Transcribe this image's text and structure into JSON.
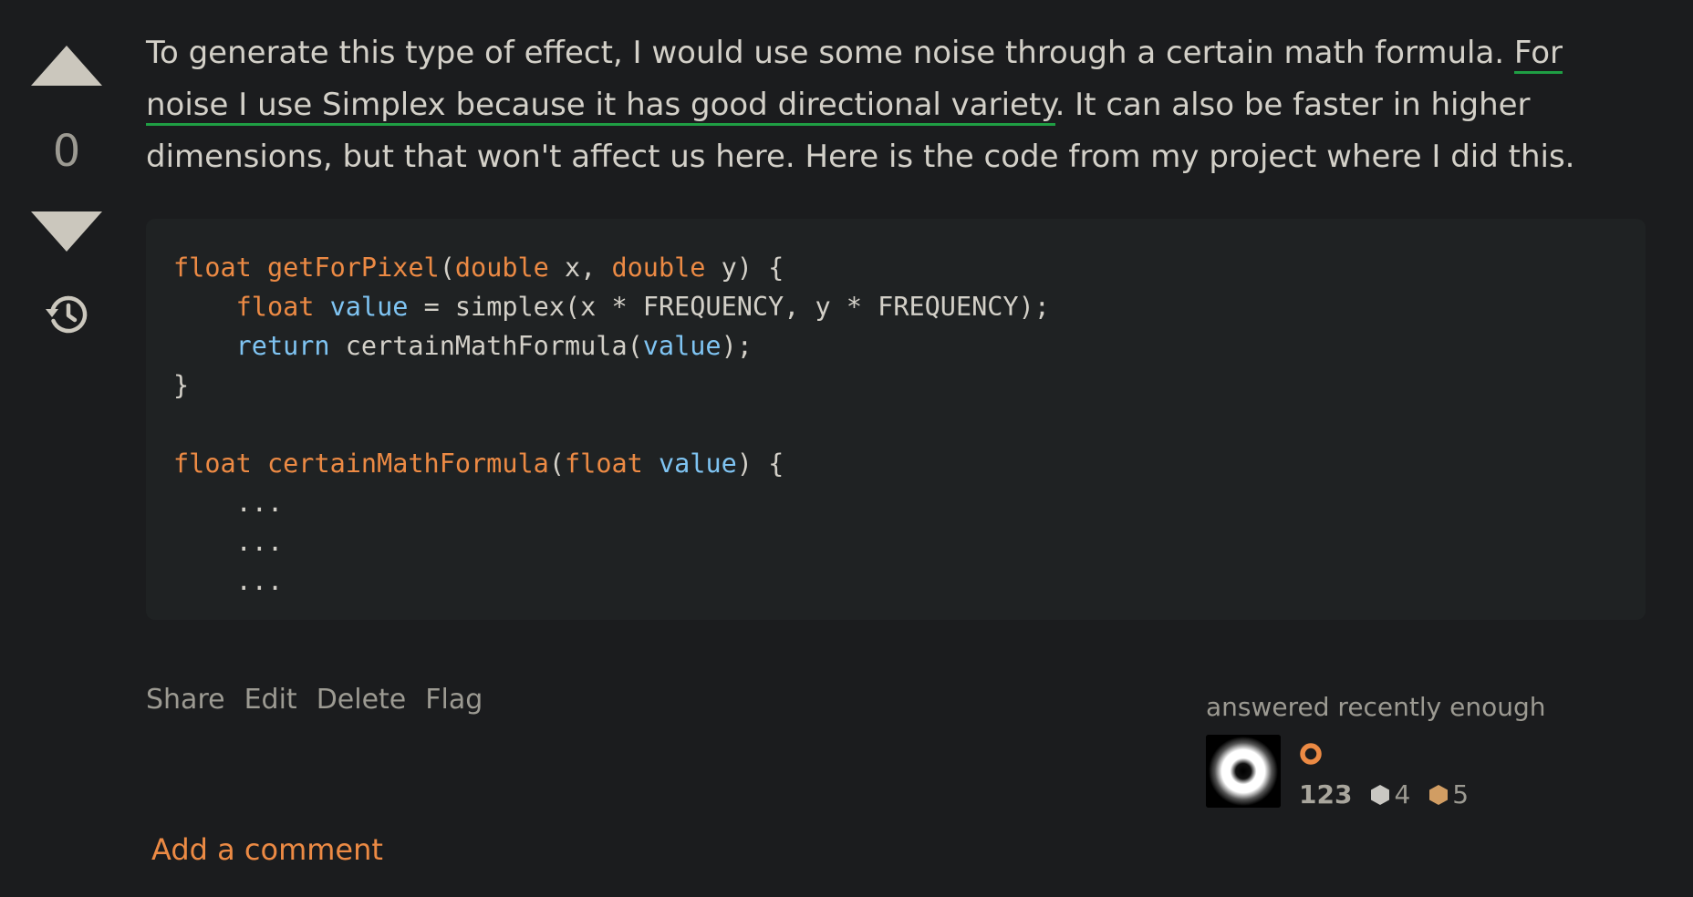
{
  "vote": {
    "count": "0"
  },
  "post": {
    "text_before_link": "To generate this type of effect, I would use some noise through a certain math formula. ",
    "link_text": "For noise I use Simplex because it has good directional variety",
    "text_after_link": ". It can also be faster in higher dimensions, but that won't affect us here. Here is the code from my project where I did this.",
    "code": {
      "l1_kw1": "float",
      "l1_fn": "getForPixel",
      "l1_p1": "(",
      "l1_kw2": "double",
      "l1_p2": " x, ",
      "l1_kw3": "double",
      "l1_p3": " y) {",
      "l2_indent": "    ",
      "l2_kw": "float",
      "l2_sp": " ",
      "l2_var": "value",
      "l2_rest": " = simplex(x * FREQUENCY, y * FREQUENCY);",
      "l3_indent": "    ",
      "l3_ret": "return",
      "l3_mid": " certainMathFormula(",
      "l3_var": "value",
      "l3_end": ");",
      "l4": "}",
      "l5": "",
      "l6_kw1": "float",
      "l6_sp1": " ",
      "l6_fn": "certainMathFormula",
      "l6_p1": "(",
      "l6_kw2": "float",
      "l6_sp2": " ",
      "l6_var": "value",
      "l6_end": ") {",
      "l7": "    ...",
      "l8": "    ...",
      "l9": "    ..."
    }
  },
  "menu": {
    "share": "Share",
    "edit": "Edit",
    "delete": "Delete",
    "flag": "Flag"
  },
  "user": {
    "action_time": "answered recently enough",
    "reputation": "123",
    "silver_badges": "4",
    "bronze_badges": "5"
  },
  "comments": {
    "add_label": "Add a comment"
  },
  "colors": {
    "background": "#1b1c1e",
    "code_background": "#1f2223",
    "keyword": "#ec8a44",
    "variable": "#7fc4f2",
    "link_underline": "#1f9f44",
    "accent": "#ec8a44",
    "silver": "#c9c7c2",
    "bronze": "#d19d63"
  },
  "icons": {
    "upvote": "triangle-up-icon",
    "downvote": "triangle-down-icon",
    "history": "history-icon",
    "user_status": "circle-ring-icon",
    "silver_badge": "hexagon-icon",
    "bronze_badge": "hexagon-icon"
  }
}
